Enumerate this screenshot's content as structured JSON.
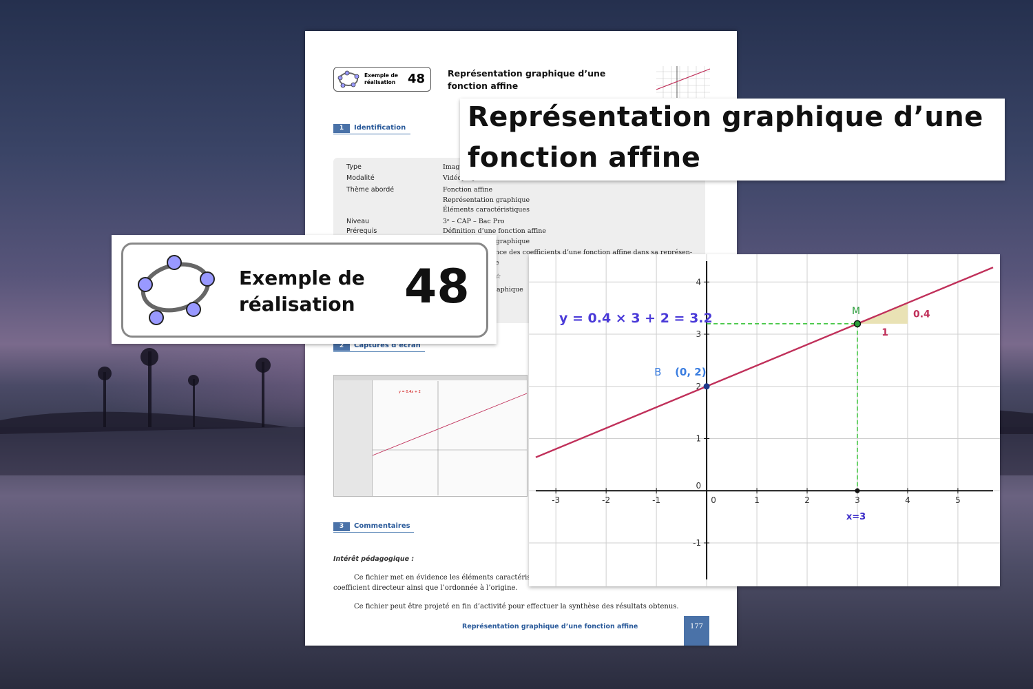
{
  "document": {
    "badge": {
      "label_line1": "Exemple de",
      "label_line2": "réalisation",
      "number": "48"
    },
    "title_line1": "Représentation graphique d’une",
    "title_line2": "fonction affine",
    "sections": [
      {
        "num": "1",
        "label": "Identification"
      },
      {
        "num": "2",
        "label": "Captures d’écran"
      },
      {
        "num": "3",
        "label": "Commentaires"
      }
    ],
    "identification": {
      "type_label": "Type",
      "type_value": "Imag",
      "modalite_label": "Modalité",
      "modalite_value": "Vidéoprojection",
      "theme_label": "Thème abordé",
      "theme_values": [
        "Fonction affine",
        "Représentation graphique",
        "Éléments caractéristiques"
      ],
      "niveau_label": "Niveau",
      "niveau_value": "3ᵉ – CAP – Bac Pro",
      "prerequis_label": "Prérequis",
      "prerequis_values": [
        "Définition d’une fonction affine",
        "Représentation graphique"
      ],
      "extra_lines": [
        "nce des coefficients d’une fonction affine dans sa représen-",
        "e",
        "☆",
        "aphique"
      ]
    },
    "comments": {
      "heading": "Intérêt pédagogique :",
      "p1_line1": "Ce fichier met en évidence les éléments caractérist",
      "p1_line2": "coefficient directeur ainsi que l’ordonnée à l’origine.",
      "p2": "Ce fichier peut être projeté en fin d’activité pour effectuer la synthèse des résultats obtenus."
    },
    "footer": {
      "title": "Représentation graphique d’une fonction affine",
      "page": "177"
    }
  },
  "screenshot": {
    "equation_label": "y = 0.4x + 2"
  },
  "chart_data": {
    "type": "line",
    "title": "",
    "xlabel": "",
    "ylabel": "",
    "xlim": [
      -3.4,
      5.7
    ],
    "ylim": [
      -1.7,
      4.4
    ],
    "x_ticks": [
      "-3",
      "-2",
      "-1",
      "0",
      "1",
      "2",
      "3",
      "4",
      "5"
    ],
    "y_ticks": [
      "-1",
      "0",
      "1",
      "2",
      "3",
      "4"
    ],
    "grid": true,
    "series": [
      {
        "slope": 0.4,
        "intercept": 2,
        "color": "#c0305a"
      }
    ],
    "points": [
      {
        "name": "B",
        "label": "(0, 2)",
        "x": 0,
        "y": 2,
        "color": "#1f3a8a",
        "label_color": "#3a7de0"
      },
      {
        "name": "M",
        "x": 3,
        "y": 3.2,
        "color": "#2a9d3a"
      }
    ],
    "annotations": {
      "equation": "y = 0.4 × 3 + 2 = 3.2",
      "x_marker": "x=3",
      "slope_run": "1",
      "slope_rise": "0.4",
      "slope_triangle_color": "#e9e2b5"
    }
  },
  "colors": {
    "accent_blue": "#4a72a8",
    "line_red": "#c0305a",
    "guide_green": "#2bbf2b"
  }
}
